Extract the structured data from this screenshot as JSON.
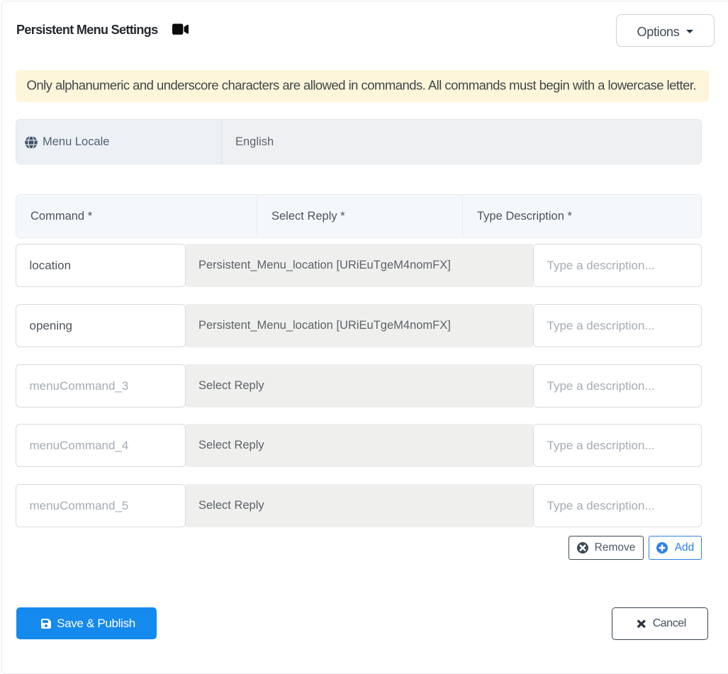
{
  "title": "Persistent Menu Settings",
  "header": {
    "options_label": "Options"
  },
  "alert": {
    "text": "Only alphanumeric and underscore characters are allowed in commands. All commands must begin with a lowercase letter."
  },
  "menu_locale": {
    "label": "Menu Locale",
    "value": "English"
  },
  "table": {
    "headers": [
      "Command *",
      "Select Reply *",
      "Type Description *"
    ],
    "rows": [
      {
        "command": "location",
        "command_placeholder": "",
        "reply": "Persistent_Menu_location [URiEuTgeM4nomFX]",
        "description": "",
        "description_placeholder": "Type a description..."
      },
      {
        "command": "opening",
        "command_placeholder": "",
        "reply": "Persistent_Menu_location [URiEuTgeM4nomFX]",
        "description": "",
        "description_placeholder": "Type a description..."
      },
      {
        "command": "",
        "command_placeholder": "menuCommand_3",
        "reply": "Select Reply",
        "description": "",
        "description_placeholder": "Type a description..."
      },
      {
        "command": "",
        "command_placeholder": "menuCommand_4",
        "reply": "Select Reply",
        "description": "",
        "description_placeholder": "Type a description..."
      },
      {
        "command": "",
        "command_placeholder": "menuCommand_5",
        "reply": "Select Reply",
        "description": "",
        "description_placeholder": "Type a description..."
      }
    ]
  },
  "actions": {
    "remove_label": "Remove",
    "add_label": "Add"
  },
  "footer": {
    "save_label": "Save & Publish",
    "cancel_label": "Cancel"
  },
  "colors": {
    "accent_blue": "#1489ee",
    "add_blue": "#2f80ec",
    "alert_bg": "#fdf6da",
    "slate": "#3d4a57"
  }
}
